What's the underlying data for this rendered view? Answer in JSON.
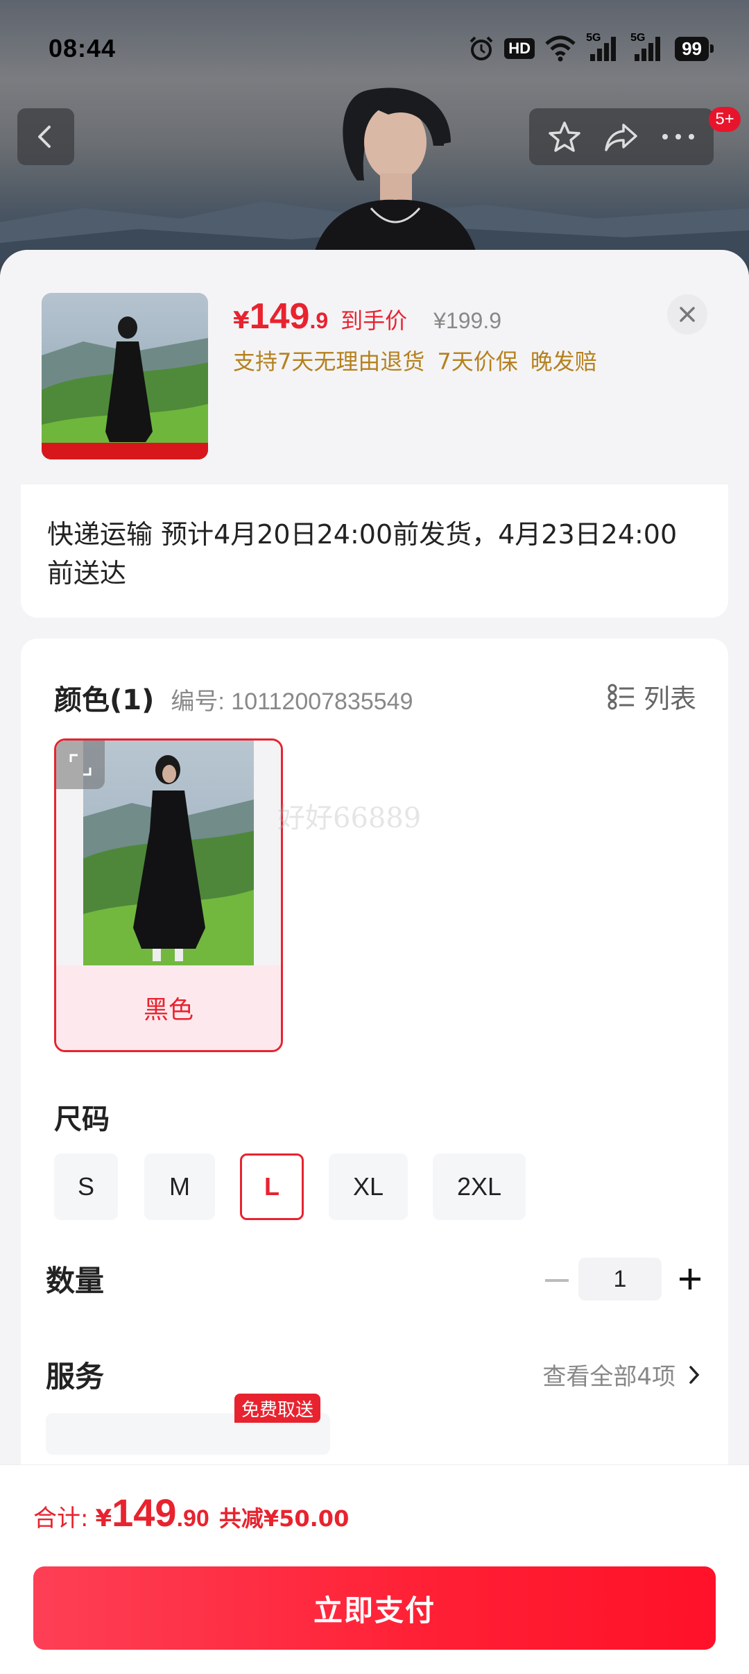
{
  "status_bar": {
    "time": "08:44",
    "battery": "99",
    "hd_label": "HD",
    "network_1": "5G",
    "network_2": "5G"
  },
  "nav": {
    "more_badge": "5+"
  },
  "product": {
    "price_symbol": "¥",
    "price_int": "149",
    "price_dec": ".9",
    "price_label": "到手价",
    "original_price": "¥199.9",
    "guarantees": [
      "支持7天无理由退货",
      "7天价保",
      "晚发赔"
    ]
  },
  "shipping": {
    "text": "快递运输 预计4月20日24:00前发货，4月23日24:00前送达"
  },
  "color": {
    "title": "颜色(1)",
    "code": "编号: 10112007835549",
    "list_toggle": "列表",
    "options": [
      {
        "label": "黑色",
        "selected": true
      }
    ],
    "watermark": "好好66889"
  },
  "size": {
    "title": "尺码",
    "options": [
      {
        "label": "S",
        "selected": false
      },
      {
        "label": "M",
        "selected": false
      },
      {
        "label": "L",
        "selected": true
      },
      {
        "label": "XL",
        "selected": false
      },
      {
        "label": "2XL",
        "selected": false
      }
    ]
  },
  "quantity": {
    "title": "数量",
    "value": "1"
  },
  "service": {
    "title": "服务",
    "more": "查看全部4项",
    "badge": "免费取送"
  },
  "footer": {
    "total_label": "合计:",
    "total_symbol": "¥",
    "total_int": "149",
    "total_dec": ".90",
    "discount": "共减¥50.00",
    "pay_button": "立即支付"
  },
  "colors": {
    "accent": "#e8232f",
    "gold": "#b5811e",
    "selected_bg": "#fde9ed"
  }
}
